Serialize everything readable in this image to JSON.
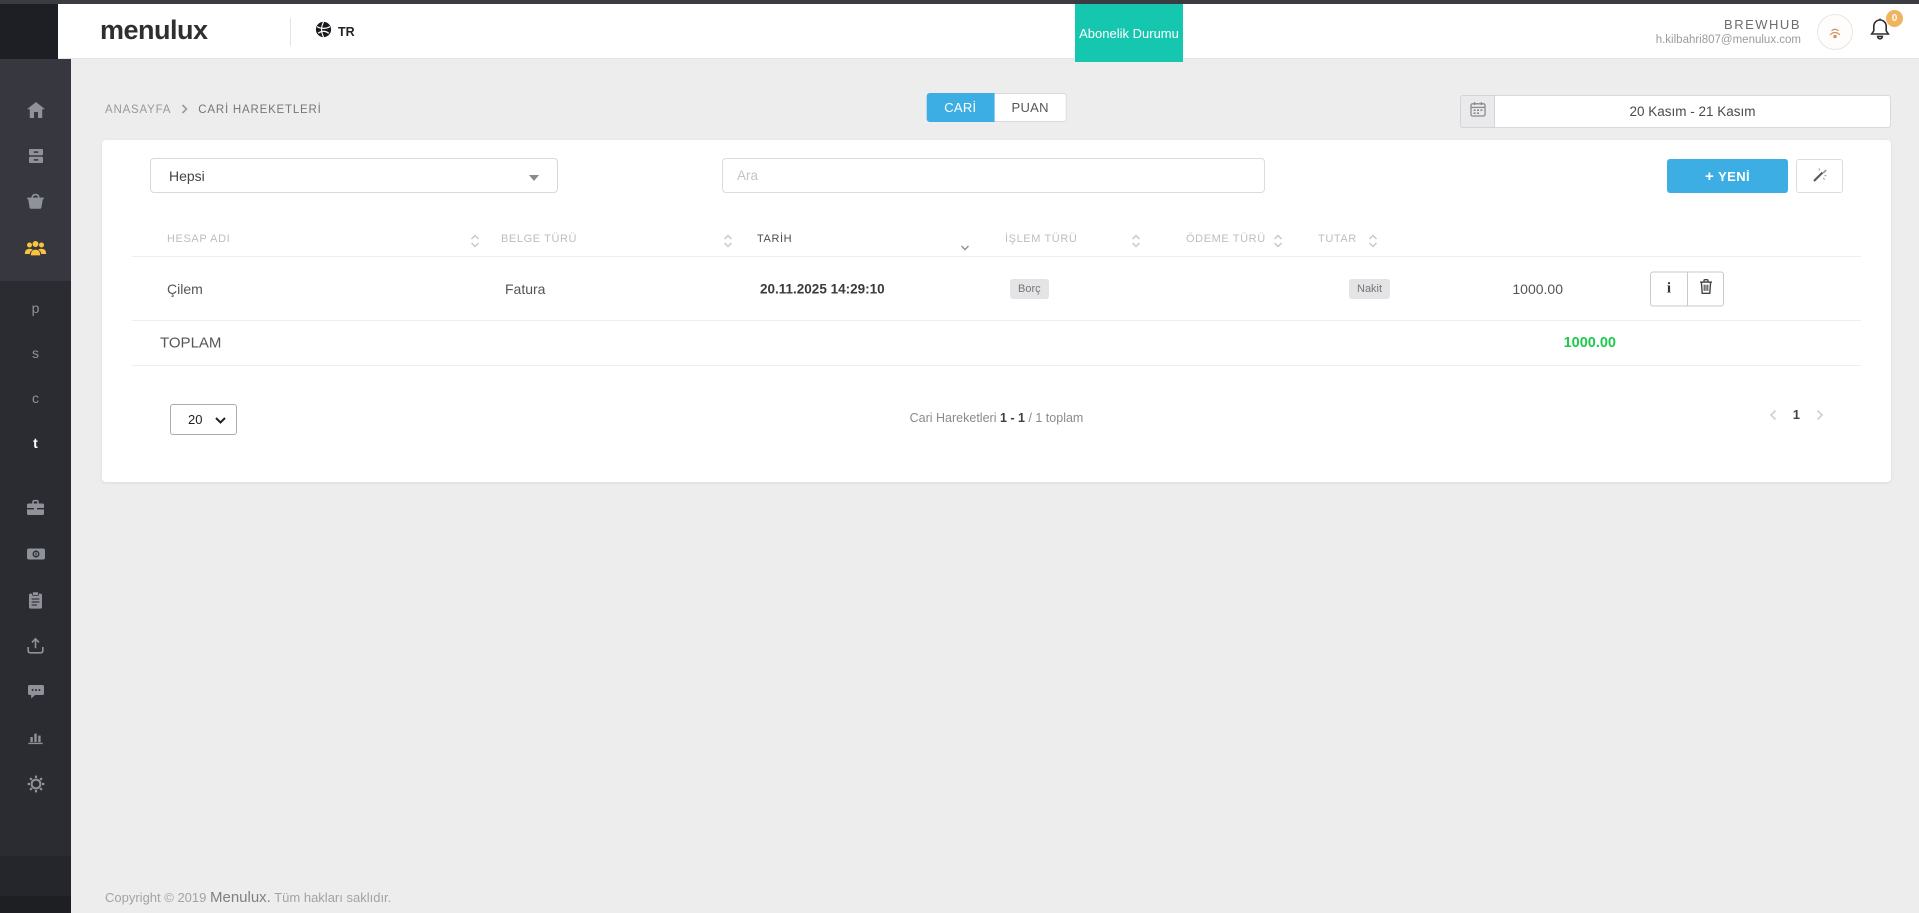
{
  "header": {
    "logo_text": "menulux",
    "language": "TR",
    "subscription_button_label": "Abonelik Durumu",
    "user_name": "BREWHUB",
    "user_email": "h.kilbahri807@menulux.com",
    "notification_count": "0"
  },
  "sidebar": {
    "icon_names": [
      "home-icon",
      "modules-icon",
      "basket-icon",
      "customers-icon",
      "briefcase-icon",
      "banknote-icon",
      "clipboard-icon",
      "export-icon",
      "chat-icon",
      "bar-chart-icon",
      "gear-icon"
    ],
    "letters": [
      "p",
      "s",
      "c",
      "t"
    ]
  },
  "breadcrumb": {
    "home": "ANASAYFA",
    "current": "CARİ HAREKETLERİ"
  },
  "tabs": {
    "cari": "CARİ",
    "puan": "PUAN"
  },
  "toolbar": {
    "date_range": "20 Kasım - 21 Kasım",
    "filter_value": "Hepsi",
    "search_placeholder": "Ara",
    "new_button_plus": "+",
    "new_button_label": "YENİ"
  },
  "table": {
    "columns": [
      "HESAP ADI",
      "BELGE TÜRÜ",
      "TARİH",
      "İŞLEM TÜRÜ",
      "ÖDEME TÜRÜ",
      "TUTAR"
    ],
    "rows": [
      {
        "hesap_adi": "Çilem",
        "belge_turu": "Fatura",
        "tarih": "20.11.2025 14:29:10",
        "islem_turu": "Borç",
        "odeme_turu": "Nakit",
        "tutar": "1000.00"
      }
    ],
    "total_label": "TOPLAM",
    "total_value": "1000.00"
  },
  "pagination": {
    "page_size": "20",
    "summary_prefix": "Cari Hareketleri ",
    "summary_bold": "1 - 1",
    "summary_suffix": " / 1 toplam",
    "current_page": "1"
  },
  "footer": {
    "copyright": "Copyright © 2019 ",
    "brand": "Menulux.",
    "rights": " Tüm hakları saklıdır."
  },
  "colors": {
    "accent_blue": "#3daee3",
    "accent_teal": "#16c7b0",
    "accent_green": "#1fc94c",
    "active_yellow": "#f9c33c",
    "badge_orange": "#f0b35e"
  }
}
